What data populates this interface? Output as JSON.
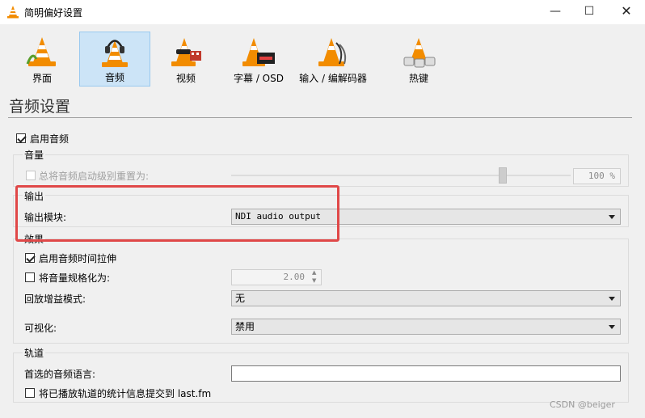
{
  "window": {
    "title": "简明偏好设置",
    "minimize": "—",
    "maximize": "☐",
    "close": "✕"
  },
  "toolbar": {
    "items": [
      {
        "label": "界面",
        "icon": "interface-cone-icon"
      },
      {
        "label": "音频",
        "icon": "audio-headphones-cone-icon",
        "selected": true
      },
      {
        "label": "视频",
        "icon": "video-cone-icon"
      },
      {
        "label": "字幕 / OSD",
        "icon": "subtitles-cone-icon"
      },
      {
        "label": "输入 / 编解码器",
        "icon": "input-codecs-cone-icon"
      },
      {
        "label": "热键",
        "icon": "hotkeys-cone-icon"
      }
    ]
  },
  "section_title": "音频设置",
  "enable_audio": {
    "label": "启用音频",
    "checked": true
  },
  "volume": {
    "group_title": "音量",
    "reset_label": "总将音频启动级别重置为:",
    "reset_checked": false,
    "level_value": "100 %",
    "level_fraction": 0.8
  },
  "output": {
    "group_title": "输出",
    "module_label": "输出模块:",
    "module_value": "NDI audio output"
  },
  "effects": {
    "group_title": "效果",
    "stretch_label": "启用音频时间拉伸",
    "stretch_checked": true,
    "normalize_label": "将音量规格化为:",
    "normalize_checked": false,
    "normalize_value": "2.00",
    "replay_gain_label": "回放增益模式:",
    "replay_gain_value": "无",
    "visualization_label": "可视化:",
    "visualization_value": "禁用"
  },
  "tracks": {
    "group_title": "轨道",
    "preferred_language_label": "首选的音频语言:",
    "preferred_language_value": "",
    "lastfm_label": "将已播放轨道的统计信息提交到 last.fm",
    "lastfm_checked": false
  },
  "watermark": "CSDN @beiger",
  "colors": {
    "highlight": "#e04848",
    "selected_tab": "#cce4f7",
    "cone_orange": "#f28c00"
  }
}
